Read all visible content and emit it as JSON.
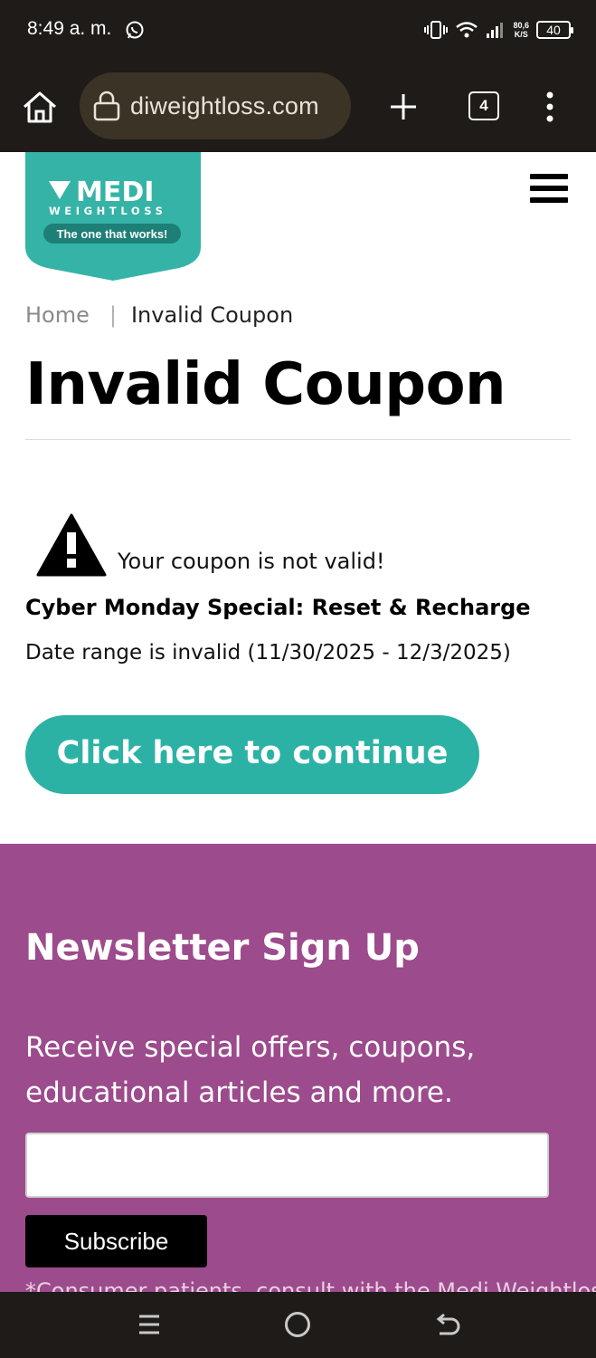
{
  "status_bar": {
    "time": "8:49 a. m.",
    "net_speed_top": "80,6",
    "net_speed_bottom": "K/S",
    "battery": "40"
  },
  "browser": {
    "url": "diweightloss.com",
    "tab_count": "4"
  },
  "logo": {
    "brand": "MEDI",
    "sub": "WEIGHTLOSS",
    "tagline": "The one that works!",
    "color": "#35b3a7"
  },
  "breadcrumb": {
    "home": "Home",
    "separator": "|",
    "current": "Invalid Coupon"
  },
  "page": {
    "title": "Invalid Coupon",
    "warning": "Your coupon is not valid!",
    "coupon_name": "Cyber Monday Special: Reset & Recharge",
    "date_range": "Date range is invalid (11/30/2025 - 12/3/2025)",
    "continue_label": "Click here to continue",
    "accent": "#2cb2a5"
  },
  "newsletter": {
    "title": "Newsletter Sign Up",
    "description": "Receive special offers, coupons, educational articles and more.",
    "email_value": "",
    "subscribe_label": "Subscribe",
    "disclaimer": "*Consumer patients, consult with the Medi Weightloss",
    "background": "#9c4b8c"
  }
}
